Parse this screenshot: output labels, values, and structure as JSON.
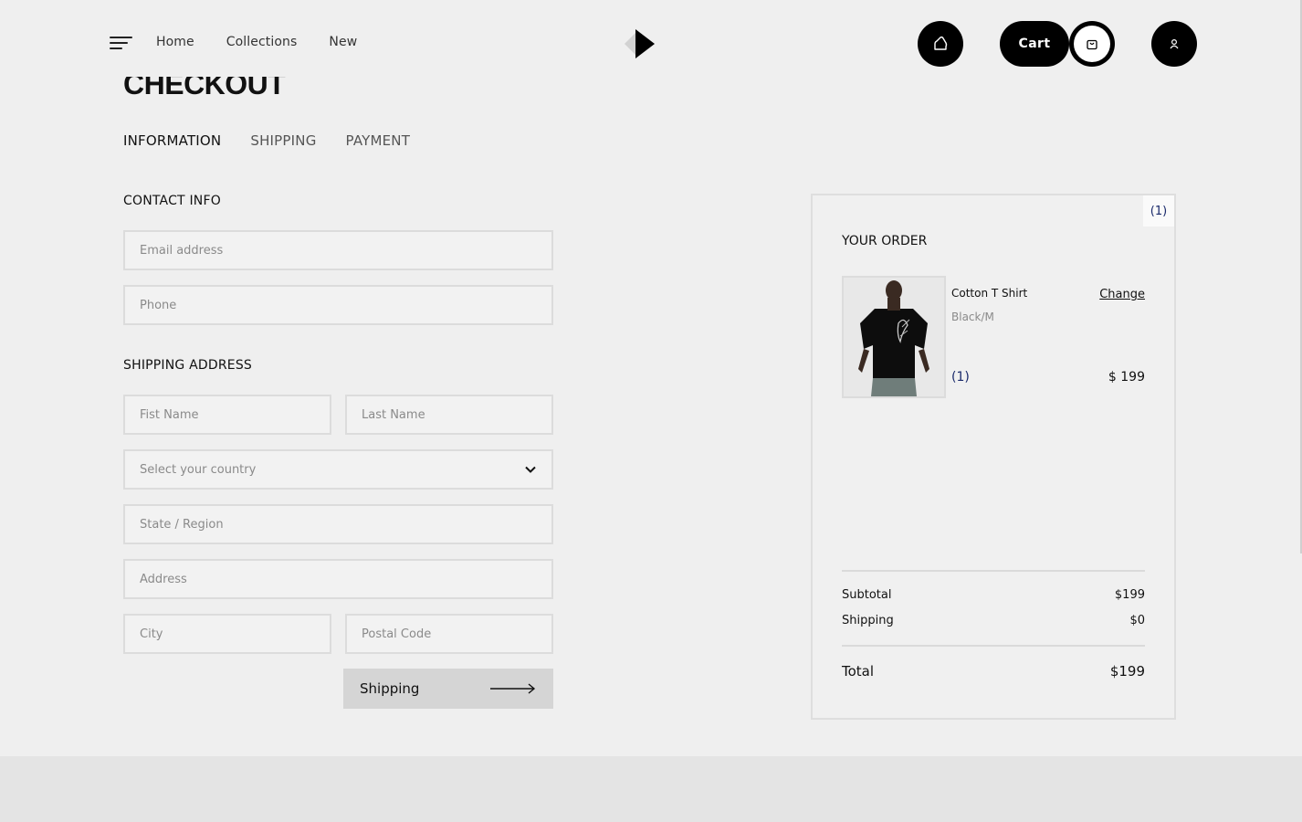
{
  "header": {
    "nav": [
      "Home",
      "Collections",
      "New"
    ],
    "cart_label": "Cart"
  },
  "page": {
    "title": "CHECKOUT",
    "steps": [
      "INFORMATION",
      "SHIPPING",
      "PAYMENT"
    ]
  },
  "contact": {
    "label": "CONTACT INFO",
    "email_placeholder": "Email address",
    "phone_placeholder": "Phone"
  },
  "shipping": {
    "label": "SHIPPING ADDRESS",
    "first_name_placeholder": "Fist Name",
    "last_name_placeholder": "Last Name",
    "country_placeholder": "Select your country",
    "state_placeholder": "State / Region",
    "address_placeholder": "Address",
    "city_placeholder": "City",
    "postal_placeholder": "Postal Code",
    "submit_label": "Shipping"
  },
  "order": {
    "count": "(1)",
    "title": "YOUR ORDER",
    "item": {
      "name": "Cotton T Shirt",
      "variant": "Black/M",
      "change_label": "Change",
      "quantity": "(1)",
      "price": "$ 199"
    },
    "subtotal_label": "Subtotal",
    "subtotal_value": "$199",
    "shipping_label": "Shipping",
    "shipping_value": "$0",
    "total_label": "Total",
    "total_value": "$199"
  },
  "icons": {
    "menu": "menu-icon",
    "logo": "diamond-play-logo",
    "bag": "bag-icon",
    "cart": "cart-icon",
    "user": "user-icon",
    "arrow": "arrow-right-icon",
    "chevron": "chevron-down-icon"
  }
}
